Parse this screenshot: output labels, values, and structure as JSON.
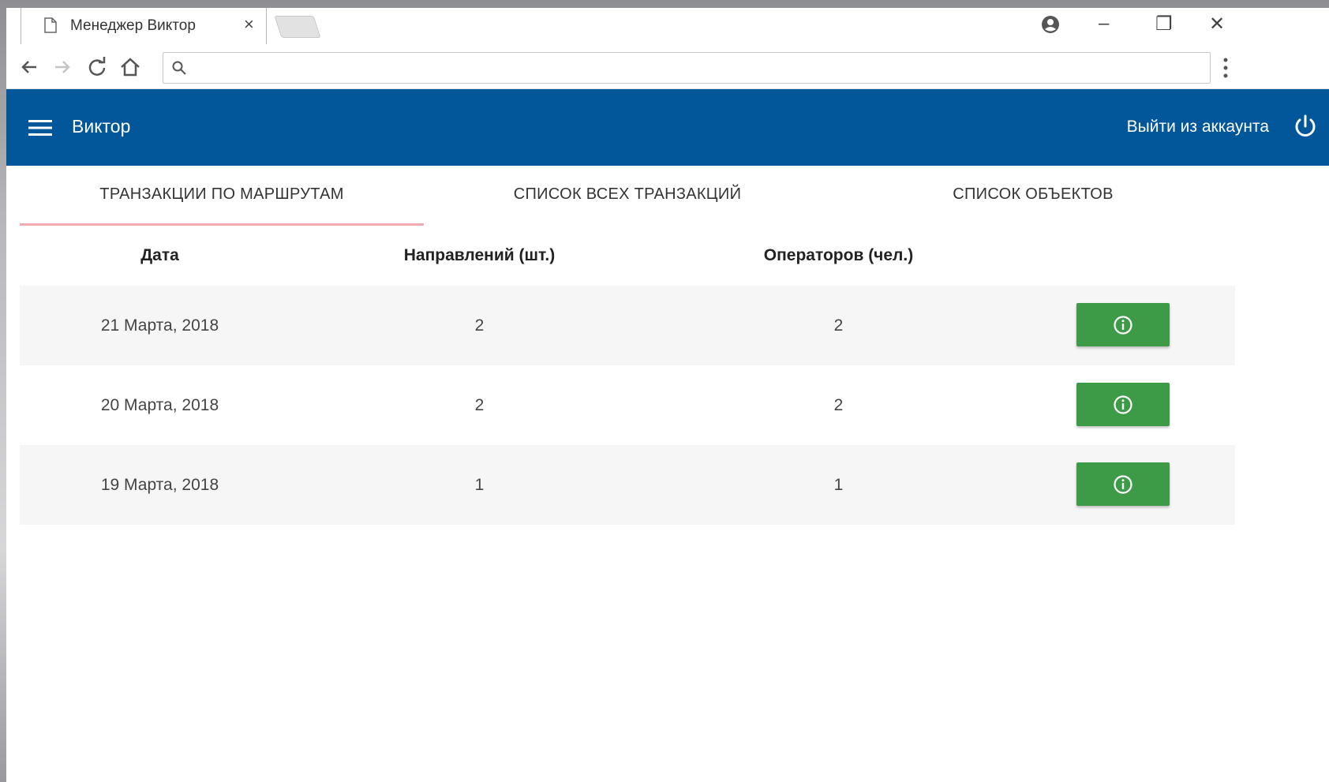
{
  "browser": {
    "tab_title": "Менеджер Виктор",
    "tab_close": "×",
    "address_value": "",
    "window_controls": {
      "account_icon": "account-circle-icon",
      "minimize": "–",
      "restore": "❐",
      "close": "✕"
    },
    "nav_icons": [
      "back-arrow-icon",
      "forward-arrow-icon",
      "reload-icon",
      "home-icon",
      "search-icon",
      "menu-dots-icon"
    ]
  },
  "header": {
    "title": "Виктор",
    "logout_label": "Выйти из аккаунта",
    "background_color": "#02579b",
    "icons": [
      "hamburger-menu-icon",
      "power-icon"
    ]
  },
  "tabs": [
    {
      "label": "ТРАНЗАКЦИИ ПО МАРШРУТАМ",
      "active": true
    },
    {
      "label": "СПИСОК ВСЕХ ТРАНЗАКЦИЙ",
      "active": false
    },
    {
      "label": "СПИСОК ОБЪЕКТОВ",
      "active": false
    }
  ],
  "table": {
    "headers": [
      "Дата",
      "Направлений (шт.)",
      "Операторов (чел.)"
    ],
    "rows": [
      {
        "date": "21 Марта, 2018",
        "directions": "2",
        "operators": "2"
      },
      {
        "date": "20 Марта, 2018",
        "directions": "2",
        "operators": "2"
      },
      {
        "date": "19 Марта, 2018",
        "directions": "1",
        "operators": "1"
      }
    ],
    "action_button_color": "#3d9a47",
    "action_icon": "info-icon"
  },
  "accent_colors": {
    "active_tab_underline": "#f4a8b0"
  }
}
